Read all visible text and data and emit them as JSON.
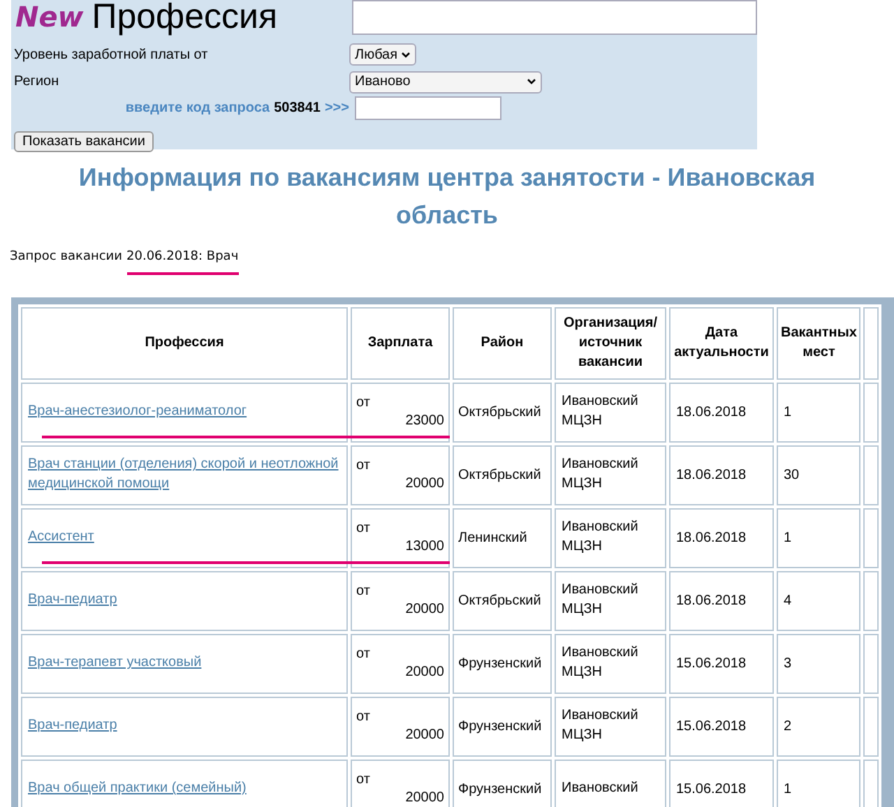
{
  "logo": {
    "badge": "New",
    "title": "Профессия"
  },
  "form": {
    "salary": {
      "label": "Уровень заработной платы от",
      "value": "Любая"
    },
    "region": {
      "label": "Регион",
      "value": "Иваново"
    },
    "code": {
      "prompt": "введите код запроса",
      "code": "503841",
      "arrows": ">>>"
    },
    "submit": "Показать вакансии"
  },
  "heading": "Информация по вакансиям центра занятости - Ивановская область",
  "request": {
    "label": "Запрос вакансии",
    "value": "20.06.2018: Врач",
    "marked": true
  },
  "table": {
    "columns": [
      "Профессия",
      "Зарплата",
      "Район",
      "Организация/ источник вакансии",
      "Дата актуальности",
      "Вакантных мест"
    ],
    "rows": [
      {
        "profession": "Врач-анестезиолог-реаниматолог",
        "from": "от",
        "salary": "23000",
        "district": "Октябрьский",
        "org": "Ивановский МЦЗН",
        "date": "18.06.2018",
        "count": "1",
        "marked": true
      },
      {
        "profession": "Врач станции (отделения) скорой и неотложной медицинской помощи",
        "from": "от",
        "salary": "20000",
        "district": "Октябрьский",
        "org": "Ивановский МЦЗН",
        "date": "18.06.2018",
        "count": "30",
        "marked": false
      },
      {
        "profession": "Ассистент",
        "from": "от",
        "salary": "13000",
        "district": "Ленинский",
        "org": "Ивановский МЦЗН",
        "date": "18.06.2018",
        "count": "1",
        "marked": true
      },
      {
        "profession": "Врач-педиатр",
        "from": "от",
        "salary": "20000",
        "district": "Октябрьский",
        "org": "Ивановский МЦЗН",
        "date": "18.06.2018",
        "count": "4",
        "marked": false
      },
      {
        "profession": "Врач-терапевт участковый",
        "from": "от",
        "salary": "20000",
        "district": "Фрунзенский",
        "org": "Ивановский МЦЗН",
        "date": "15.06.2018",
        "count": "3",
        "marked": false
      },
      {
        "profession": "Врач-педиатр",
        "from": "от",
        "salary": "20000",
        "district": "Фрунзенский",
        "org": "Ивановский МЦЗН",
        "date": "15.06.2018",
        "count": "2",
        "marked": false
      },
      {
        "profession": "Врач общей практики (семейный)",
        "from": "от",
        "salary": "20000",
        "district": "Фрунзенский",
        "org": "Ивановский",
        "date": "15.06.2018",
        "count": "1",
        "marked": false
      }
    ]
  }
}
